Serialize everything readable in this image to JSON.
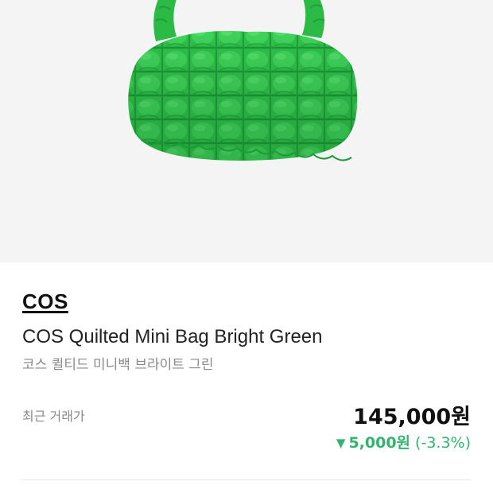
{
  "product": {
    "brand": "COS",
    "name_en": "COS Quilted Mini Bag Bright Green",
    "name_ko": "코스 퀼티드 미니백 브라이트 그린",
    "image_icon": "quilted-bag-image",
    "color_accent": "#2fc24a"
  },
  "price": {
    "label": "최근 거래가",
    "value": "145,000원",
    "change_arrow": "▼",
    "change_amount": "5,000원",
    "change_percent": "(-3.3%)",
    "change_color": "#31b46e"
  }
}
